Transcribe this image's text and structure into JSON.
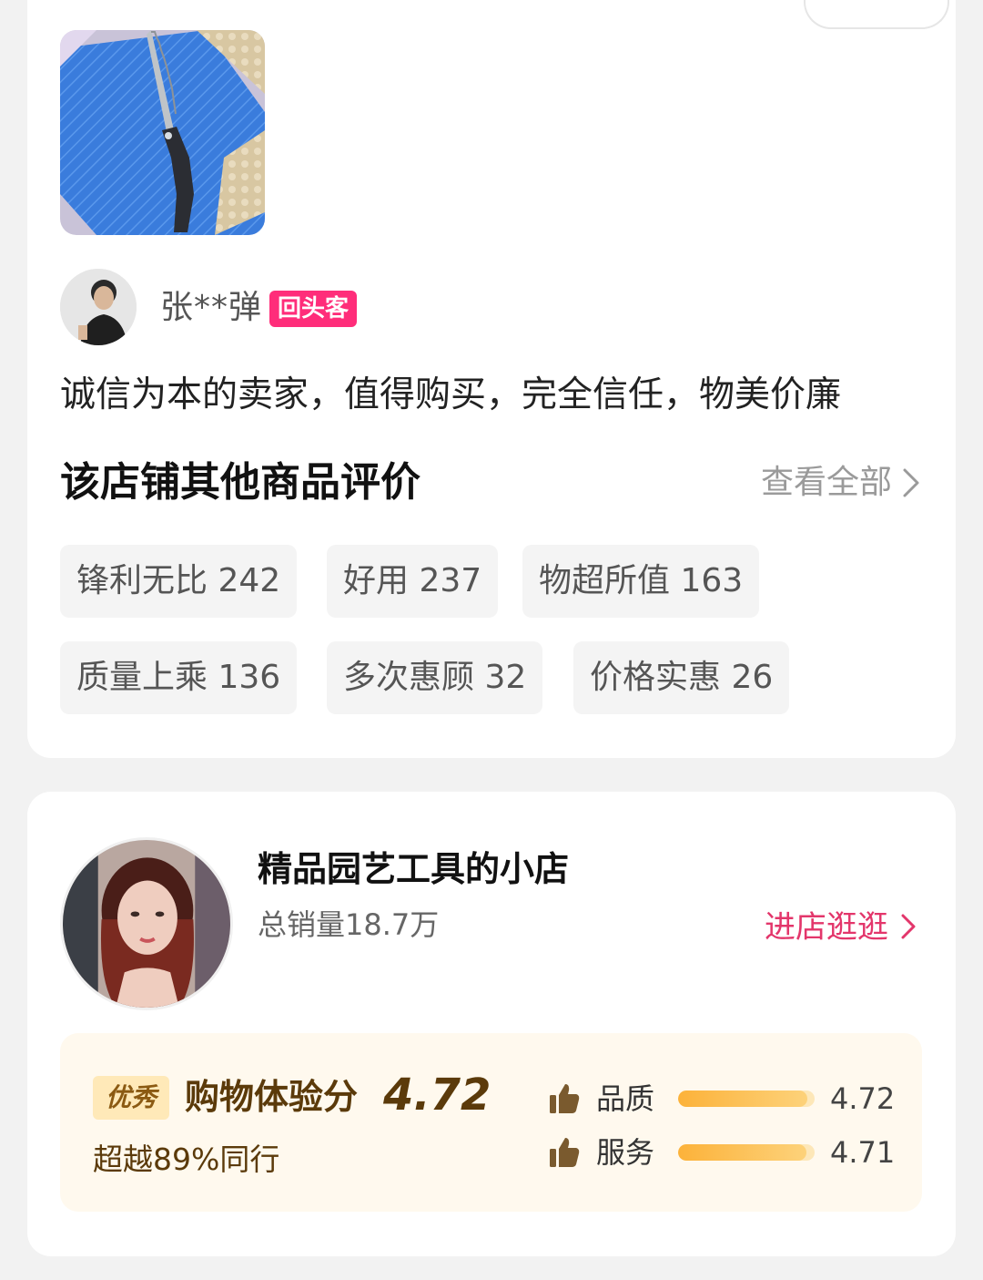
{
  "review": {
    "reviewer_name": "张**弹",
    "reviewer_badge": "回头客",
    "text": "诚信为本的卖家，值得购买，完全信任，物美价廉"
  },
  "other_reviews": {
    "title": "该店铺其他商品评价",
    "view_all_label": "查看全部",
    "tags": [
      {
        "label": "锋利无比 242"
      },
      {
        "label": "好用 237"
      },
      {
        "label": "物超所值 163"
      },
      {
        "label": "质量上乘 136"
      },
      {
        "label": "多次惠顾 32"
      },
      {
        "label": "价格实惠 26"
      }
    ]
  },
  "shop": {
    "name": "精品园艺工具的小店",
    "sales": "总销量18.7万",
    "enter_label": "进店逛逛",
    "score": {
      "badge": "优秀",
      "label": "购物体验分",
      "value": "4.72",
      "beat_text": "超越89%同行",
      "metrics": [
        {
          "label": "品质",
          "value": "4.72",
          "level": 0.944,
          "icon": "thumbs-up-icon"
        },
        {
          "label": "服务",
          "value": "4.71",
          "level": 0.942,
          "icon": "thumbs-up-icon"
        }
      ]
    }
  },
  "colors": {
    "accent_pink": "#e3366b",
    "badge_pink": "#ff2d7a",
    "score_brown": "#5b3a0a",
    "bar_orange": "#fcb23a"
  }
}
